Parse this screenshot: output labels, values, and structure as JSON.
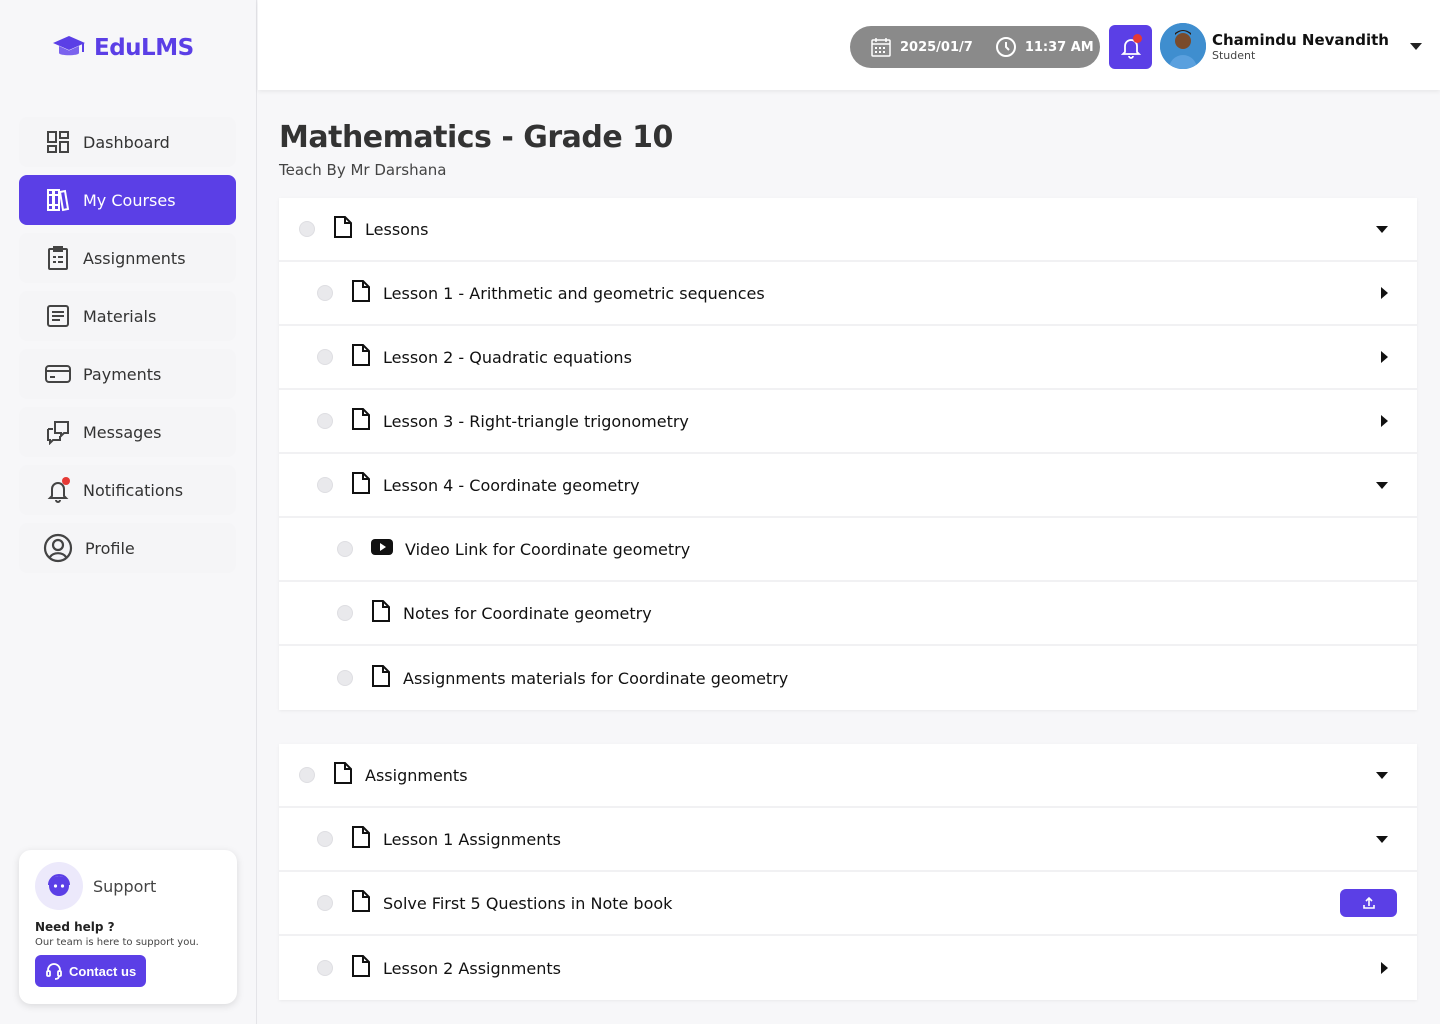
{
  "brand": {
    "name": "EduLMS",
    "color": "#5b3fe6"
  },
  "sidebar": {
    "items": [
      {
        "label": "Dashboard",
        "icon": "dashboard-icon",
        "active": false
      },
      {
        "label": "My Courses",
        "icon": "books-icon",
        "active": true
      },
      {
        "label": "Assignments",
        "icon": "clipboard-icon",
        "active": false
      },
      {
        "label": "Materials",
        "icon": "document-list-icon",
        "active": false
      },
      {
        "label": "Payments",
        "icon": "credit-card-icon",
        "active": false
      },
      {
        "label": "Messages",
        "icon": "chat-icon",
        "active": false
      },
      {
        "label": "Notifications",
        "icon": "bell-icon",
        "active": false
      },
      {
        "label": "Profile",
        "icon": "user-circle-icon",
        "active": false
      }
    ]
  },
  "support": {
    "title": "Support",
    "need_help": "Need help ?",
    "subtitle": "Our team is here to support you.",
    "contact_label": "Contact us"
  },
  "header": {
    "date": "2025/01/7",
    "time": "11:37 AM",
    "user": {
      "name": "Chamindu Nevandith",
      "role": "Student"
    }
  },
  "course": {
    "title": "Mathematics - Grade 10",
    "teacher": "Teach By Mr Darshana"
  },
  "sections": [
    {
      "title": "Lessons",
      "rows": [
        {
          "label": "Lesson 1 - Arithmetic and geometric sequences",
          "level": 1,
          "icon": "document-icon",
          "action": "expand-right"
        },
        {
          "label": "Lesson 2 - Quadratic equations",
          "level": 1,
          "icon": "document-icon",
          "action": "expand-right"
        },
        {
          "label": "Lesson 3 - Right-triangle trigonometry",
          "level": 1,
          "icon": "document-icon",
          "action": "expand-right"
        },
        {
          "label": "Lesson 4 - Coordinate geometry",
          "level": 1,
          "icon": "document-icon",
          "action": "collapse-down"
        },
        {
          "label": "Video Link for Coordinate geometry",
          "level": 2,
          "icon": "youtube-icon",
          "action": "none"
        },
        {
          "label": "Notes for Coordinate geometry",
          "level": 2,
          "icon": "document-icon",
          "action": "none"
        },
        {
          "label": "Assignments materials for Coordinate geometry",
          "level": 2,
          "icon": "document-icon",
          "action": "none"
        }
      ]
    },
    {
      "title": "Assignments",
      "rows": [
        {
          "label": "Lesson 1 Assignments",
          "level": 1,
          "icon": "document-icon",
          "action": "collapse-down"
        },
        {
          "label": "Solve First 5 Questions in Note book",
          "level": 1,
          "icon": "document-icon",
          "action": "upload"
        },
        {
          "label": "Lesson 2 Assignments",
          "level": 1,
          "icon": "document-icon",
          "action": "expand-right"
        }
      ]
    }
  ]
}
